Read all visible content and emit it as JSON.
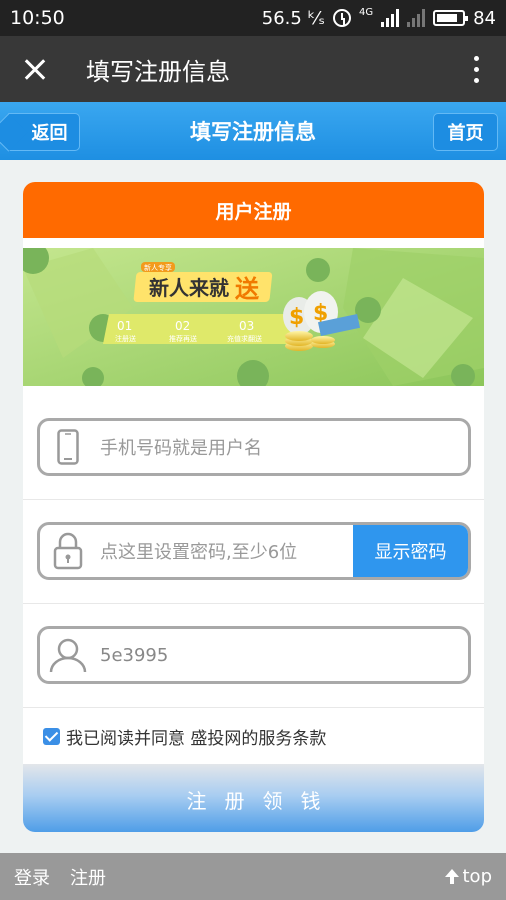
{
  "status": {
    "time": "10:50",
    "speed": "56.5 ᵏ⁄ₛ",
    "network": "4G",
    "battery": "84",
    "battery_level": 0.84
  },
  "appbar": {
    "title": "填写注册信息",
    "close_icon": "close-icon",
    "more_icon": "more-vert-icon"
  },
  "navbar": {
    "back_label": "返回",
    "title": "填写注册信息",
    "home_label": "首页"
  },
  "card": {
    "header": "用户注册",
    "banner": {
      "tag": "新人专享",
      "headline_a": "新人来就",
      "headline_b": "送",
      "steps": [
        {
          "num": "01",
          "label": "注册送"
        },
        {
          "num": "02",
          "label": "推荐再送"
        },
        {
          "num": "03",
          "label": "充值求翻送"
        }
      ]
    },
    "phone": {
      "placeholder": "手机号码就是用户名",
      "icon": "phone-icon"
    },
    "password": {
      "placeholder": "点这里设置密码,至少6位",
      "show_label": "显示密码",
      "icon": "lock-icon"
    },
    "referrer": {
      "value": "5e3995",
      "icon": "user-icon"
    },
    "agree": {
      "text": "我已阅读并同意 盛投网的服务条款",
      "checked": true
    },
    "submit_label": "注册领钱"
  },
  "footer": {
    "login": "登录",
    "register": "注册",
    "top": "top"
  },
  "colors": {
    "accent_blue": "#2f96ee",
    "header_orange": "#ff6a00",
    "banner_green": "#a6d46d"
  }
}
